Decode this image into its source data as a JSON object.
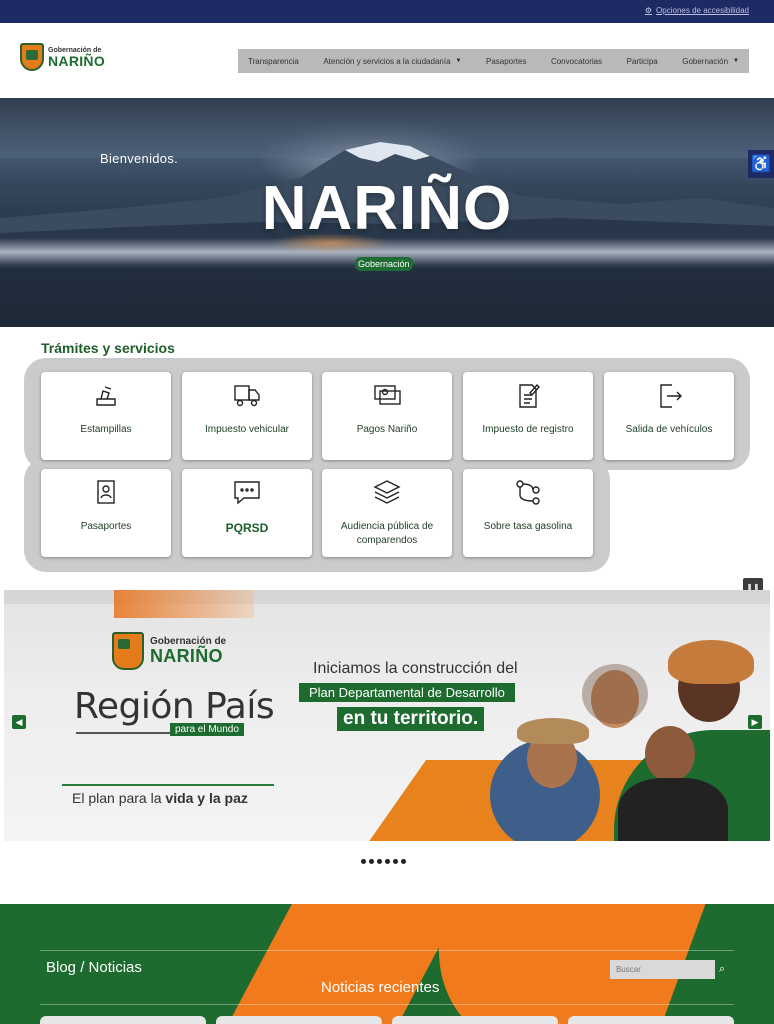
{
  "topbar": {
    "accessibility_label": "Opciones de accesibilidad",
    "icon": "gear-icon"
  },
  "logo": {
    "line1": "Gobernación de",
    "line2": "NARIÑO"
  },
  "nav": {
    "items": [
      {
        "label": "Transparencia",
        "has_dropdown": false
      },
      {
        "label": "Atención y servicios a la ciudadanía",
        "has_dropdown": true
      },
      {
        "label": "Pasaportes",
        "has_dropdown": false
      },
      {
        "label": "Convocatorias",
        "has_dropdown": false
      },
      {
        "label": "Participa",
        "has_dropdown": false
      },
      {
        "label": "Gobernación",
        "has_dropdown": true
      }
    ]
  },
  "hero": {
    "welcome": "Bienvenidos.",
    "title": "NARIÑO",
    "badge": "Gobernación"
  },
  "accessibility_side_icon": "wheelchair-icon",
  "tramites": {
    "title": "Trámites y servicios",
    "items": [
      {
        "label": "Estampillas",
        "icon": "stamp-icon"
      },
      {
        "label": "Impuesto vehicular",
        "icon": "truck-icon"
      },
      {
        "label": "Pagos Nariño",
        "icon": "payment-icon"
      },
      {
        "label": "Impuesto de registro",
        "icon": "document-edit-icon"
      },
      {
        "label": "Salida de vehículos",
        "icon": "exit-icon"
      },
      {
        "label": "Pasaportes",
        "icon": "passport-icon"
      },
      {
        "label": "PQRSD",
        "icon": "chat-icon"
      },
      {
        "label": "Audiencia pública de comparendos",
        "icon": "layers-icon"
      },
      {
        "label": "Sobre tasa gasolina",
        "icon": "flow-icon"
      }
    ]
  },
  "banner": {
    "logo_line1": "Gobernación de",
    "logo_line2": "NARIÑO",
    "region": "Región País",
    "region_sub": "para el Mundo",
    "plan_prefix": "El plan para la ",
    "plan_bold": "vida y la paz",
    "headline1": "Iniciamos la construcción del",
    "headline2": "Plan Departamental de Desarrollo",
    "headline3": "en tu territorio.",
    "slide_count": 6
  },
  "footer": {
    "blog_title": "Blog / Noticias",
    "recent_title": "Noticias recientes",
    "search_placeholder": "Buscar"
  },
  "colors": {
    "navy": "#1e2a63",
    "green": "#1e6b2f",
    "orange": "#f07a1c"
  }
}
